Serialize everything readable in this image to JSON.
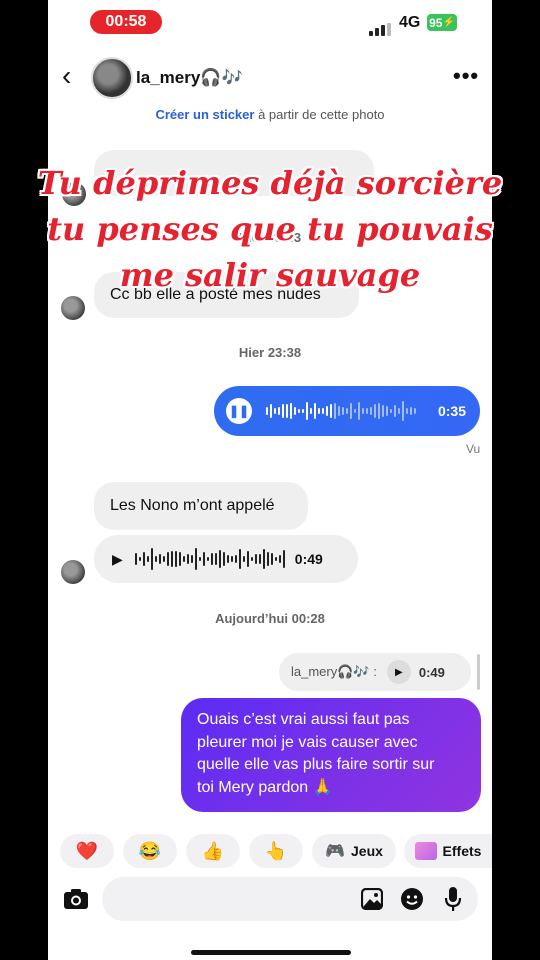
{
  "status_bar": {
    "time": "00:58",
    "network": "4G",
    "battery": "95"
  },
  "header": {
    "name": "la_mery🎧🎶"
  },
  "sticker_prompt": {
    "link": "Créer un sticker",
    "rest": " à partir de cette photo"
  },
  "caption": {
    "lines": [
      "Tu déprimes déjà sorcière",
      "tu penses que tu pouvais",
      "me salir sauvage"
    ]
  },
  "messages": {
    "ts1": "Hier 23:33",
    "msg1": "Cc bb elle a posté mes nudes",
    "ts2": "Hier 23:38",
    "audio_out_duration": "0:35",
    "seen": "Vu",
    "msg2": "Les Nono m’ont appelé",
    "audio_in_duration": "0:49",
    "ts3": "Aujourd’hui 00:28",
    "reply_name": "la_mery🎧🎶 :",
    "reply_duration": "0:49",
    "out_text_lines": [
      "Ouais c’est vrai aussi faut pas",
      "pleurer moi je vais causer avec",
      "quelle elle vas plus faire sortir sur",
      "toi Mery pardon 🙏"
    ]
  },
  "reactions": [
    {
      "icon": "heart-icon",
      "glyph": "❤️"
    },
    {
      "icon": "laugh-icon",
      "glyph": "😂"
    },
    {
      "icon": "thumbs-up-icon",
      "glyph": "👍"
    },
    {
      "icon": "point-icon",
      "glyph": "👆"
    }
  ],
  "chips": {
    "games": "Jeux",
    "effects": "Effets"
  },
  "colors": {
    "accent_blue": "#2f6cf0",
    "purple": "#7a31e8",
    "caption_red": "#e5222f",
    "time_pill": "#e5252a"
  }
}
